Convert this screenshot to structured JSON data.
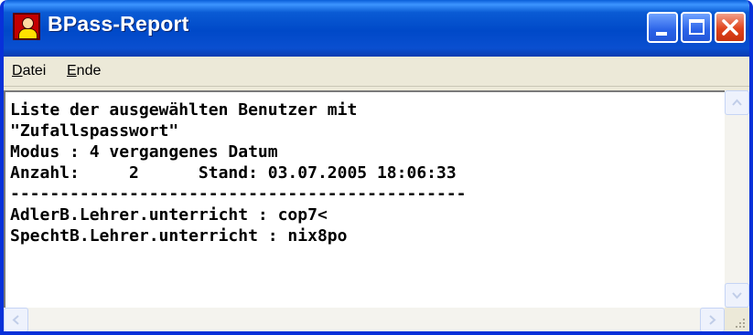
{
  "window": {
    "title": "BPass-Report",
    "icon": "user-key-icon"
  },
  "titlebar_buttons": [
    "minimize-icon",
    "maximize-icon",
    "close-icon"
  ],
  "menu": {
    "items": [
      {
        "label_first": "D",
        "label_rest": "atei"
      },
      {
        "label_first": "E",
        "label_rest": "nde"
      }
    ]
  },
  "report": {
    "lines": [
      "Liste der ausgewählten Benutzer mit",
      "\"Zufallspasswort\"",
      "Modus : 4 vergangenes Datum",
      "Anzahl:     2      Stand: 03.07.2005 18:06:33",
      "----------------------------------------------",
      "AdlerB.Lehrer.unterricht : cop7<",
      "SpechtB.Lehrer.unterricht : nix8po"
    ]
  },
  "colors": {
    "titlebar": "#0054e3",
    "window_border": "#0831d9",
    "close_button": "#e0441c",
    "text_background": "#ffffff"
  }
}
